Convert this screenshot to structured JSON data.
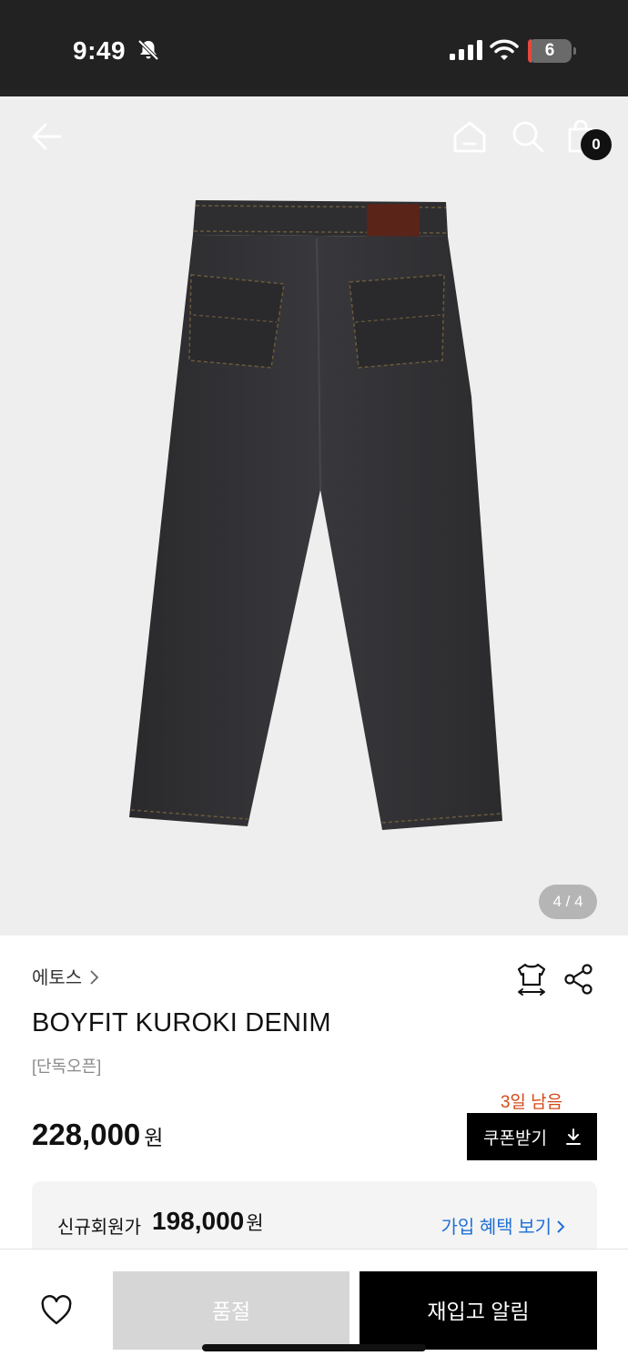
{
  "status_bar": {
    "time": "9:49",
    "battery": "6",
    "icons": [
      "bell-slash-icon",
      "signal-icon",
      "wifi-icon",
      "battery-icon"
    ]
  },
  "top_nav": {
    "icons": [
      "back-arrow-icon",
      "home-icon",
      "search-icon",
      "shopping-bag-icon"
    ],
    "cart_count": "0"
  },
  "gallery": {
    "pager": "4 / 4"
  },
  "product": {
    "brand": "에토스",
    "name": "BOYFIT KUROKI DENIM",
    "tag": "[단독오픈]",
    "price_amount": "228,000",
    "price_unit": "원",
    "icons": [
      "size-guide-icon",
      "share-icon"
    ]
  },
  "coupon": {
    "days_left": "3일 남음",
    "button_label": "쿠폰받기"
  },
  "member_price": {
    "label": "신규회원가",
    "amount": "198,000",
    "unit": "원",
    "link": "가입 혜택 보기"
  },
  "bottom_bar": {
    "soldout_label": "품절",
    "restock_label": "재입고 알림"
  },
  "colors": {
    "status_bar_bg": "#222222",
    "hero_bg": "#eeeeee",
    "accent_orange": "#d34a17",
    "link_blue": "#1f6fd6",
    "button_black": "#000000",
    "button_disabled": "#d6d6d6"
  }
}
